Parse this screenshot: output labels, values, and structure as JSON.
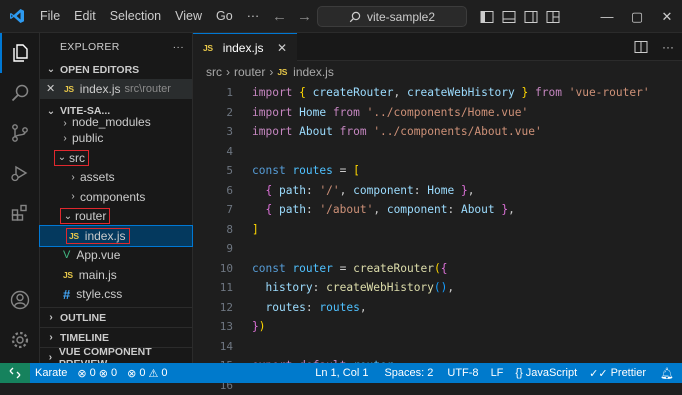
{
  "menu": [
    "File",
    "Edit",
    "Selection",
    "View",
    "Go"
  ],
  "search": {
    "text": "vite-sample2"
  },
  "sidebar": {
    "title": "EXPLORER",
    "more": "···",
    "open_editors": {
      "header": "OPEN EDITORS",
      "file": "index.js",
      "path": "src\\router"
    },
    "project": {
      "header": "VITE-SA...",
      "items": [
        {
          "label": "node_modules"
        },
        {
          "label": "public"
        },
        {
          "label": "src"
        },
        {
          "label": "assets"
        },
        {
          "label": "components"
        },
        {
          "label": "router"
        },
        {
          "label": "index.js",
          "badge": "JS"
        },
        {
          "label": "App.vue",
          "badge": "V"
        },
        {
          "label": "main.js",
          "badge": "JS"
        },
        {
          "label": "style.css",
          "badge": "#"
        }
      ]
    },
    "sections": [
      "OUTLINE",
      "TIMELINE",
      "VUE COMPONENT PREVIEW"
    ]
  },
  "tab": {
    "badge": "JS",
    "label": "index.js"
  },
  "breadcrumb": {
    "part1": "src",
    "part2": "router",
    "badge": "JS",
    "file": "index.js"
  },
  "editor": {
    "line_numbers": [
      "1",
      "2",
      "3",
      "4",
      "5",
      "6",
      "7",
      "8",
      "9",
      "10",
      "11",
      "12",
      "13",
      "14",
      "15",
      "16"
    ]
  },
  "status": {
    "karate": "Karate",
    "errors": "0",
    "warnings": "0",
    "info": "0",
    "info2": "0",
    "position": "Ln 1, Col 1",
    "spaces": "Spaces: 2",
    "encoding": "UTF-8",
    "eol": "LF",
    "language": "JavaScript",
    "formatter": "Prettier"
  },
  "colors": {
    "accent": "#007acc",
    "highlight_box": "#e0282e",
    "selection": "#04395e"
  }
}
